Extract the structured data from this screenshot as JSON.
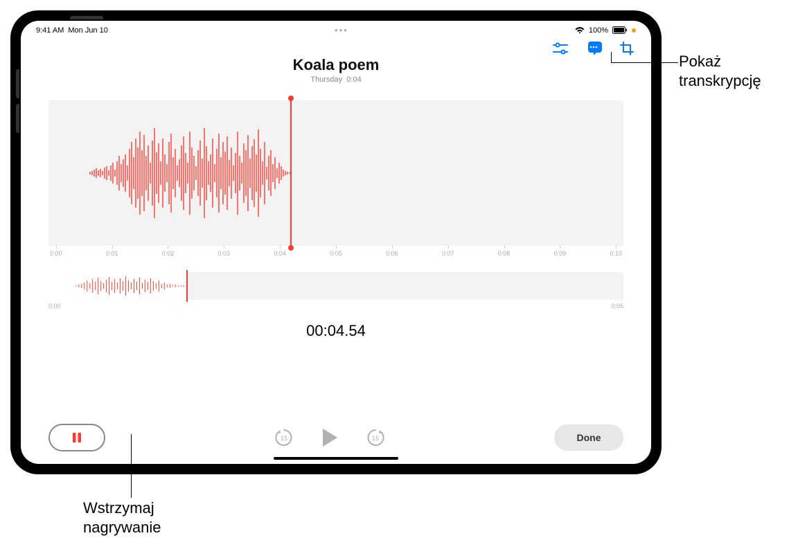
{
  "status": {
    "time": "9:41 AM",
    "date": "Mon Jun 10",
    "wifi": "100%",
    "battery": "100%"
  },
  "header": {
    "title": "Koala poem",
    "subtitle_day": "Thursday",
    "subtitle_duration": "0:04"
  },
  "toolbar": {
    "settings_icon": "settings-sliders-icon",
    "transcript_icon": "speech-bubble-icon",
    "crop_icon": "crop-icon"
  },
  "waveform": {
    "ticks": [
      "0:00",
      "0:01",
      "0:02",
      "0:03",
      "0:04",
      "0:05",
      "0:06",
      "0:07",
      "0:08",
      "0:09",
      "0:10"
    ],
    "playhead_position_pct": 42,
    "overview_start": "0:00",
    "overview_end": "0:05",
    "overview_progress_pct": 24
  },
  "timecode": "00:04.54",
  "controls": {
    "rewind_amount": "15",
    "forward_amount": "15",
    "done_label": "Done"
  },
  "callouts": {
    "show_transcript": "Pokaż\ntranskrypcję",
    "pause_recording": "Wstrzymaj\nnagrywanie"
  },
  "colors": {
    "accent_red": "#ff3b30",
    "accent_blue": "#007aff"
  }
}
